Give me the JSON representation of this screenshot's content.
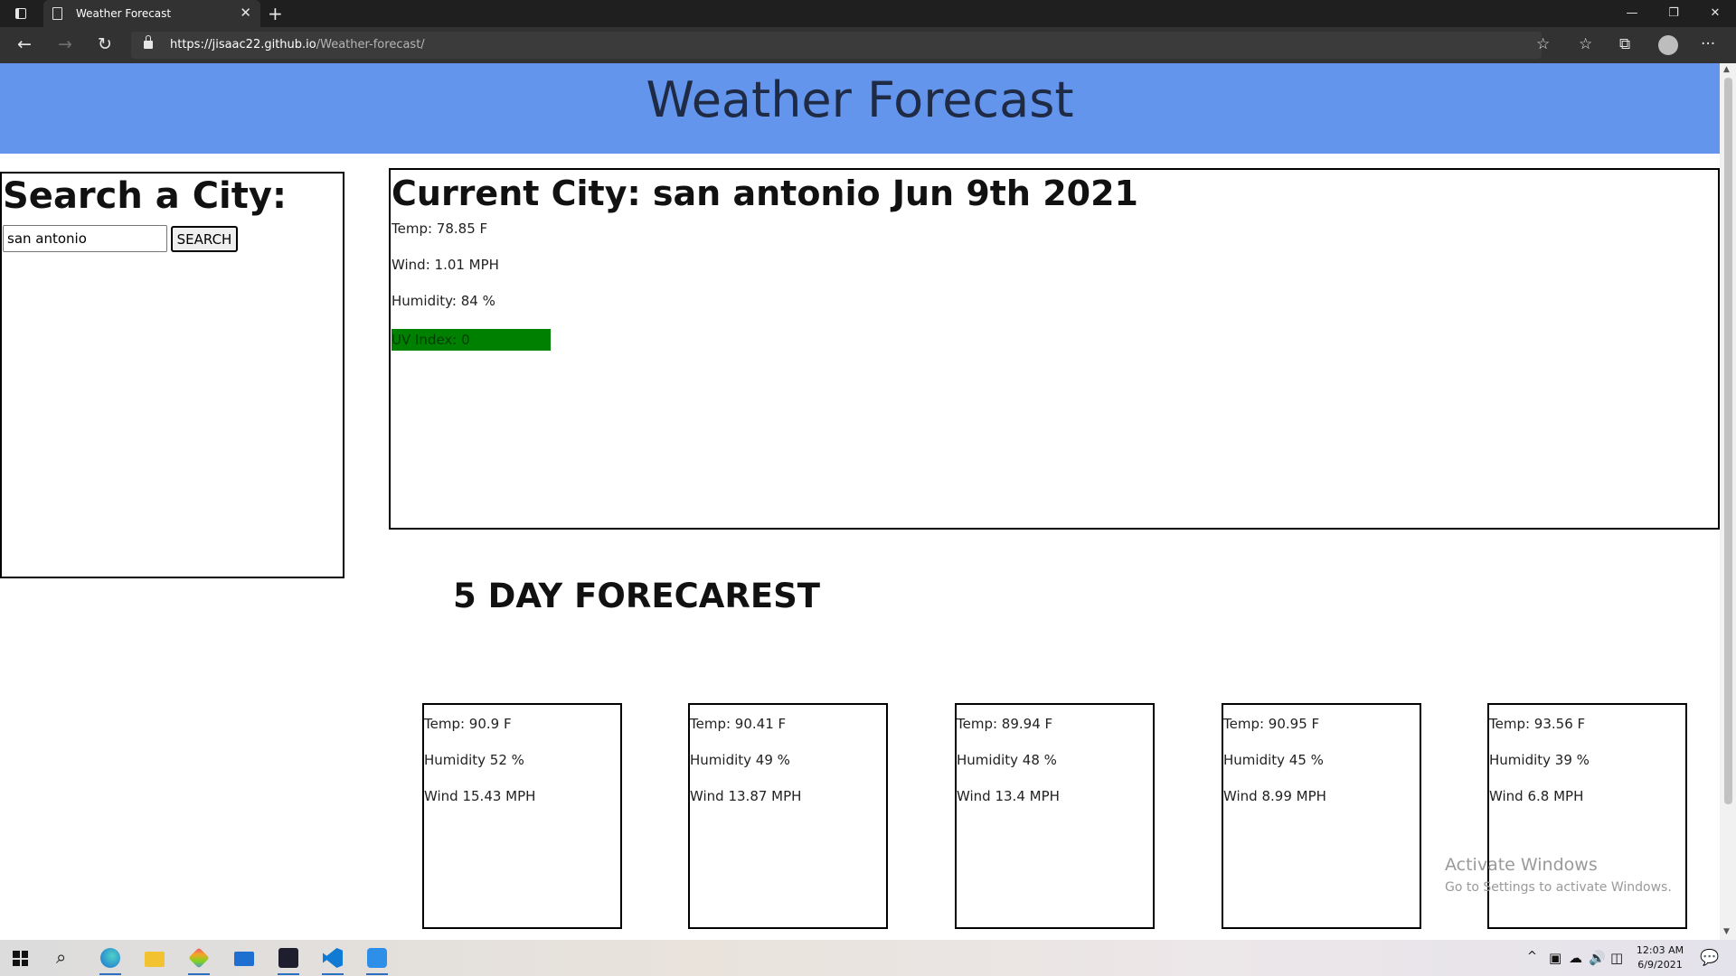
{
  "browser": {
    "tab_title": "Weather Forecast",
    "tab_close": "✕",
    "new_tab": "+",
    "url_host": "https://jisaac22.github.io",
    "url_path": "/Weather-forecast/",
    "window_controls": {
      "minimize": "—",
      "restore": "❐",
      "close": "✕"
    },
    "nav": {
      "back": "←",
      "forward": "→",
      "refresh": "↻"
    },
    "toolbar_icons": {
      "favorite": "☆",
      "favorites": "☆",
      "collections": "⧉",
      "menu": "···"
    }
  },
  "page": {
    "title": "Weather Forecast",
    "search": {
      "heading": "Search a City:",
      "input_value": "san antonio",
      "button_label": "SEARCH"
    },
    "current": {
      "heading": "Current City: san antonio Jun 9th 2021",
      "temp": "Temp: 78.85 F",
      "wind": "Wind: 1.01 MPH",
      "humidity": "Humidity: 84 %",
      "uv": "UV Index: 0",
      "uv_color": "#008000"
    },
    "forecast": {
      "heading": "5 DAY FORECAREST",
      "days": [
        {
          "temp": "Temp: 90.9 F",
          "humidity": "Humidity 52 %",
          "wind": "Wind 15.43 MPH"
        },
        {
          "temp": "Temp: 90.41 F",
          "humidity": "Humidity 49 %",
          "wind": "Wind 13.87 MPH"
        },
        {
          "temp": "Temp: 89.94 F",
          "humidity": "Humidity 48 %",
          "wind": "Wind 13.4 MPH"
        },
        {
          "temp": "Temp: 90.95 F",
          "humidity": "Humidity 45 %",
          "wind": "Wind 8.99 MPH"
        },
        {
          "temp": "Temp: 93.56 F",
          "humidity": "Humidity 39 %",
          "wind": "Wind 6.8 MPH"
        }
      ]
    },
    "header_color": "#6495ed"
  },
  "watermark": {
    "title": "Activate Windows",
    "subtitle": "Go to Settings to activate Windows."
  },
  "taskbar": {
    "apps": [
      "edge-icon",
      "file-explorer-icon",
      "git-icon",
      "mail-icon",
      "terminal-icon",
      "vscode-icon",
      "app-icon"
    ],
    "tray": {
      "chevron": "^",
      "network": "◫",
      "volume": "🔊",
      "notification": "💬"
    },
    "time": "12:03 AM",
    "date": "6/9/2021"
  }
}
